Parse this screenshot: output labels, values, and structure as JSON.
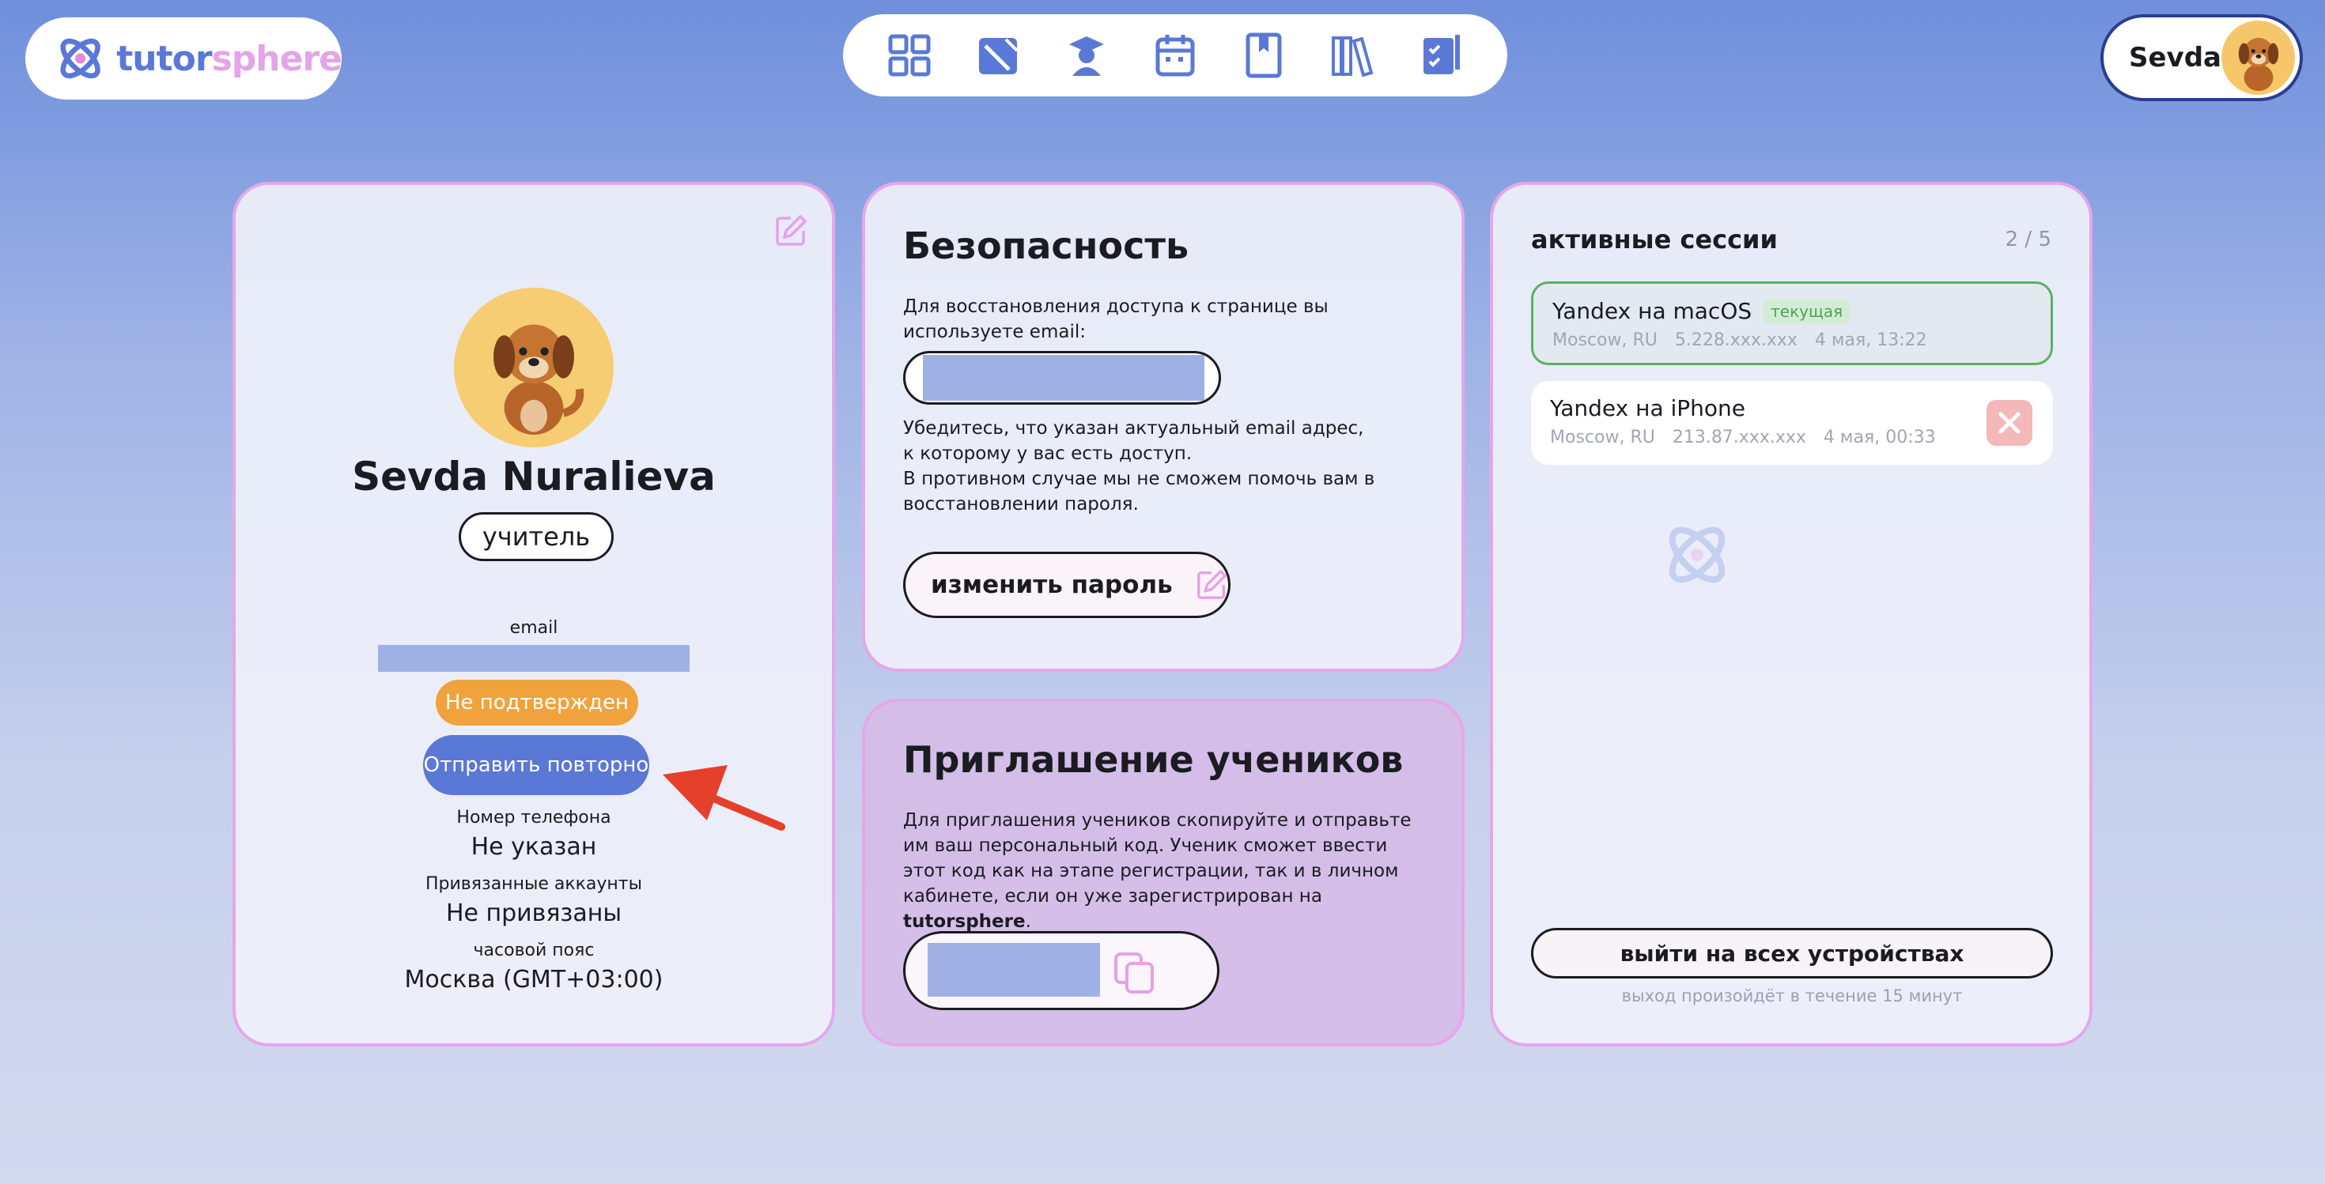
{
  "header": {
    "logo_part1": "tutor",
    "logo_part2": "sphere",
    "nav_icons": [
      "dashboard-grid-icon",
      "lessons-icon",
      "students-icon",
      "calendar-icon",
      "bookmark-book-icon",
      "library-icon",
      "homework-icon"
    ],
    "user_name": "Sevda"
  },
  "profile": {
    "name": "Sevda Nuralieva",
    "role": "учитель",
    "email_label": "email",
    "email_status": "Не подтвержден",
    "resend_label": "Отправить повторно",
    "phone_label": "Номер телефона",
    "phone_value": "Не указан",
    "accounts_label": "Привязанные аккаунты",
    "accounts_value": "Не привязаны",
    "timezone_label": "часовой пояс",
    "timezone_value": "Москва (GMT+03:00)"
  },
  "security": {
    "title": "Безопасность",
    "intro": "Для восстановления доступа к странице вы используете email:",
    "warning_1": "Убедитесь, что указан актуальный email адрес, к которому у вас есть доступ.",
    "warning_2": "В противном случае мы не сможем помочь вам в восстановлении пароля.",
    "change_password": "изменить пароль"
  },
  "invite": {
    "title": "Приглашение учеников",
    "text": "Для приглашения учеников скопируйте и отправьте им ваш персональный код. Ученик сможет ввести этот код как на этапе регистрации, так и в личном кабинете, если он уже зарегистрирован на",
    "brand": "tutorsphere",
    "dot": "."
  },
  "sessions": {
    "title": "активные сессии",
    "count": "2 / 5",
    "items": [
      {
        "name": "Yandex на macOS",
        "tag": "текущая",
        "city": "Moscow, RU",
        "ip": "5.228.xxx.xxx",
        "time": "4 мая, 13:22"
      },
      {
        "name": "Yandex на iPhone",
        "city": "Moscow, RU",
        "ip": "213.87.xxx.xxx",
        "time": "4 мая, 00:33"
      }
    ],
    "logout_all": "выйти на всех устройствах",
    "logout_note": "выход произойдёт в течение 15 минут"
  },
  "colors": {
    "accent": "#5a78d6",
    "pink_border": "#e6a7ea",
    "warning": "#f0a33c",
    "success": "#5cb062",
    "danger_soft": "#f4b8b8"
  }
}
